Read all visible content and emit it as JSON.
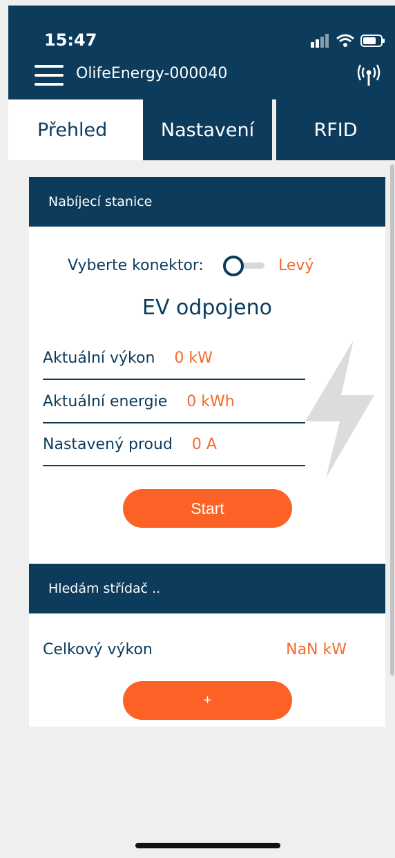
{
  "status_bar": {
    "time": "15:47",
    "icons": [
      "signal-icon",
      "wifi-icon",
      "battery-icon"
    ]
  },
  "app_bar": {
    "title": "OlifeEnergy-000040",
    "left_icon": "hamburger-menu-icon",
    "right_icon": "wireless-connection-icon"
  },
  "tabs": [
    {
      "label": "Přehled",
      "active": true
    },
    {
      "label": "Nastavení",
      "active": false
    },
    {
      "label": "RFID",
      "active": false
    }
  ],
  "station_card": {
    "header": "Nabíjecí stanice",
    "connector_label": "Vyberte konektor:",
    "connector_value": "Levý",
    "ev_status": "EV odpojeno",
    "metrics": [
      {
        "label": "Aktuální výkon",
        "value": "0 kW"
      },
      {
        "label": "Aktuální energie",
        "value": "0 kWh"
      },
      {
        "label": "Nastavený proud",
        "value": "0 A"
      }
    ],
    "start_button": "Start",
    "decor_icon": "lightning-bolt-icon"
  },
  "inverter_card": {
    "header": "Hledám střídač ..",
    "total_label": "Celkový výkon",
    "total_value": "NaN kW",
    "add_button": "+"
  },
  "colors": {
    "primary": "#0c3b5c",
    "accent": "#fc6226",
    "value_text": "#f26a2d",
    "background": "#efefef"
  }
}
